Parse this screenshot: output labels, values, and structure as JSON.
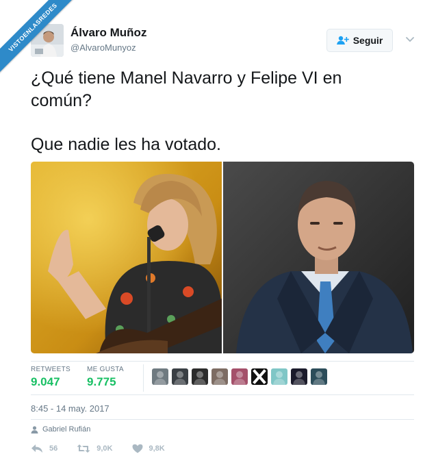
{
  "watermark": {
    "text": "VISTOENLASREDES"
  },
  "author": {
    "display_name": "Álvaro Muñoz",
    "handle": "@AlvaroMunyoz"
  },
  "follow_button": {
    "label": "Seguir",
    "icon": "add-user-icon"
  },
  "tweet": {
    "text_line1": "¿Qué tiene Manel Navarro y Felipe VI en común?",
    "text_line2": "Que nadie les ha votado."
  },
  "stats": {
    "retweets_label": "RETWEETS",
    "retweets_value": "9.047",
    "likes_label": "ME GUSTA",
    "likes_value": "9.775"
  },
  "likers": [
    {
      "icon": "avatar",
      "bg": "#6f7a80"
    },
    {
      "icon": "avatar",
      "bg": "#3a3f44"
    },
    {
      "icon": "avatar",
      "bg": "#2b2b2b"
    },
    {
      "icon": "avatar",
      "bg": "#7d6c63"
    },
    {
      "icon": "avatar",
      "bg": "#a4506a"
    },
    {
      "icon": "x-logo-avatar",
      "bg": "#111111"
    },
    {
      "icon": "avatar",
      "bg": "#7fc6c6"
    },
    {
      "icon": "avatar",
      "bg": "#1b1b2b"
    },
    {
      "icon": "avatar",
      "bg": "#2c4d5a"
    }
  ],
  "timestamp": "8:45 - 14 may. 2017",
  "attribution": {
    "icon": "person-icon",
    "name": "Gabriel Rufián"
  },
  "actions": {
    "reply_count": "56",
    "retweet_count": "9,0K",
    "like_count": "9,8K"
  },
  "colors": {
    "accent_blue": "#1da1f2",
    "like_green": "#17bf63",
    "secondary_text": "#657786",
    "banner_blue": "#2e8ac9"
  }
}
